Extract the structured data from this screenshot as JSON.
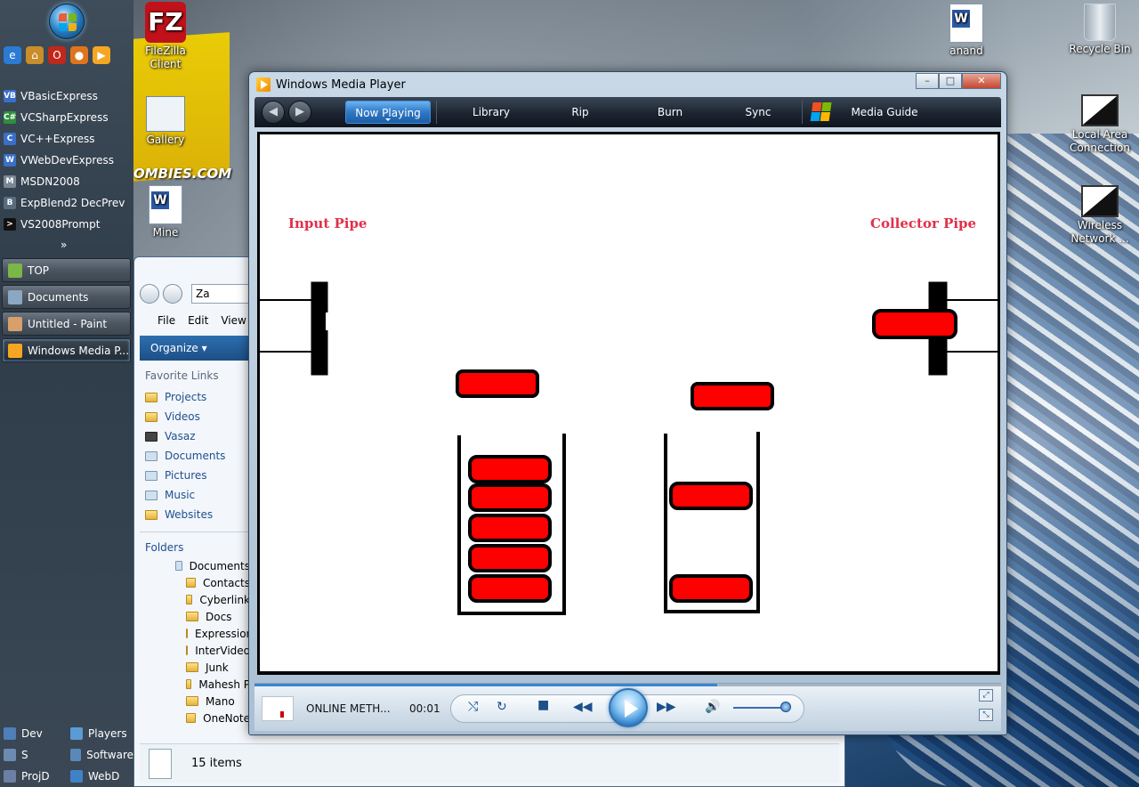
{
  "quick_launch": {
    "icons": [
      "ie-icon",
      "home-icon",
      "opera-icon",
      "firefox-icon",
      "media-icon"
    ],
    "programs": [
      {
        "label": "VBasicExpress",
        "color": "#3a6fc9"
      },
      {
        "label": "VCSharpExpress",
        "color": "#2f8f3f"
      },
      {
        "label": "VC++Express",
        "color": "#3a6fc9"
      },
      {
        "label": "VWebDevExpress",
        "color": "#3a6fc9"
      },
      {
        "label": "MSDN2008",
        "color": "#7a8896"
      },
      {
        "label": "ExpBlend2 DecPrev",
        "color": "#5a6c7e"
      },
      {
        "label": "VS2008Prompt",
        "color": "#111111"
      }
    ],
    "expand": "»"
  },
  "taskbar": {
    "buttons": [
      {
        "label": "TOP",
        "color": "#7ab648",
        "active": false
      },
      {
        "label": "Documents",
        "color": "#8ba7c2",
        "active": false
      },
      {
        "label": "Untitled - Paint",
        "color": "#d7a06a",
        "active": false
      },
      {
        "label": "Windows Media P...",
        "color": "#f5a623",
        "active": true
      }
    ]
  },
  "bottom_links": [
    [
      {
        "label": "Dev",
        "color": "#4f7fb8"
      },
      {
        "label": "Players",
        "color": "#5b9bd5"
      }
    ],
    [
      {
        "label": "S",
        "color": "#6b8bb0"
      },
      {
        "label": "Software",
        "color": "#5a88b8"
      }
    ],
    [
      {
        "label": "ProjD",
        "color": "#6c7fa5"
      },
      {
        "label": "WebD",
        "color": "#3f82c8"
      }
    ]
  ],
  "desktop_icons": {
    "filezilla": {
      "label": "FileZilla Client",
      "glyph": "FZ"
    },
    "gallery": {
      "label": "Gallery"
    },
    "mine": {
      "label": "Mine"
    },
    "anand": {
      "label": "anand"
    },
    "recycle": {
      "label": "Recycle Bin"
    },
    "lan": {
      "label": "Local Area Connection"
    },
    "wireless": {
      "label": "Wireless Network ..."
    },
    "logo_text": "OMBIES.COM"
  },
  "explorer": {
    "address": "Za",
    "menu": [
      "File",
      "Edit",
      "View"
    ],
    "organize": "Organize",
    "favorite_links_title": "Favorite Links",
    "favorites": [
      "Projects",
      "Videos",
      "Vasaz",
      "Documents",
      "Pictures",
      "Music",
      "Websites"
    ],
    "folders_title": "Folders",
    "tree_root": "Documents",
    "tree": [
      "Contacts",
      "Cyberlink",
      "Docs",
      "Expression",
      "InterVideo",
      "Junk",
      "Mahesh P",
      "Mano",
      "OneNote"
    ],
    "status": "15 items"
  },
  "wmp": {
    "title": "Windows Media Player",
    "window_controls": {
      "minimize": "–",
      "maximize": "□",
      "close": "✕"
    },
    "tabs": {
      "now_playing": "Now Playing",
      "library": "Library",
      "rip": "Rip",
      "burn": "Burn",
      "sync": "Sync",
      "media_guide": "Media Guide"
    },
    "video": {
      "input_pipe_label": "Input Pipe",
      "collector_pipe_label": "Collector Pipe",
      "accent": "#ff0000"
    },
    "player": {
      "track": "ONLINE METH...",
      "time": "00:01",
      "seek_progress": 0.62,
      "volume": 0.85
    }
  }
}
